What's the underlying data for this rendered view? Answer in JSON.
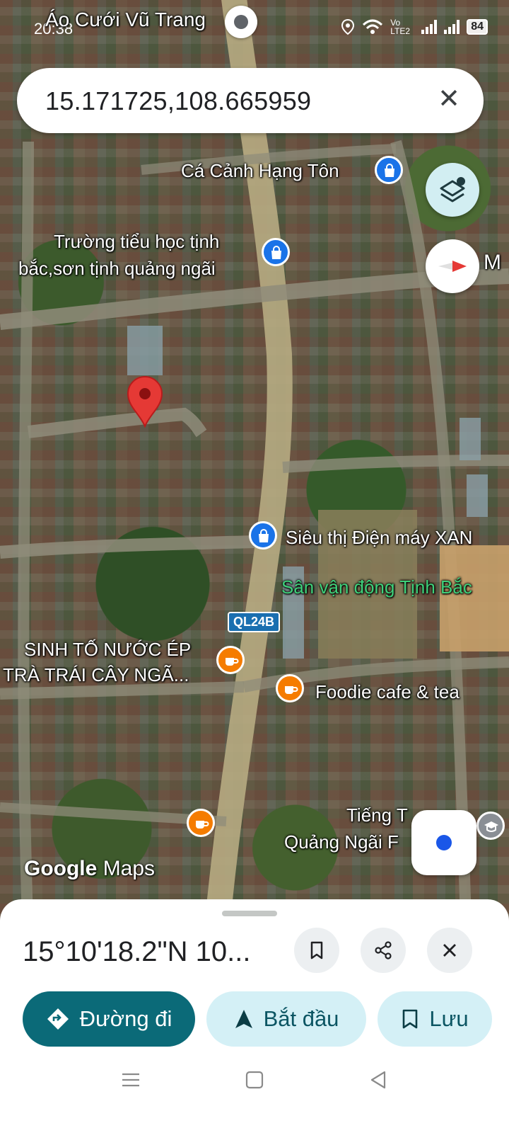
{
  "status_bar": {
    "time": "20:38",
    "network": "Vo LTE2",
    "battery": "84"
  },
  "search": {
    "query": "15.171725,108.665959"
  },
  "map": {
    "labels": {
      "top_place": "Áo Cưới Vũ Trang",
      "ca_canh": "Cá Cảnh Hạng Tôn",
      "school_line1": "Trường tiểu học tịnh",
      "school_line2": "bắc,sơn tịnh quảng ngãi",
      "edge_label": "M",
      "electronics": "Siêu thị Điện máy XAN",
      "stadium": "Sân vận động Tịnh Bắc",
      "route": "QL24B",
      "juice_line1": "SINH TỐ NƯỚC ÉP",
      "juice_line2": "TRÀ TRÁI CÂY NGÃ...",
      "foodie": "Foodie cafe & tea",
      "tieng_line1": "Tiếng T",
      "tieng_line2": "Quảng Ngãi F"
    },
    "watermark_google": "Google",
    "watermark_maps": "Maps"
  },
  "sheet": {
    "coordinates_title": "15°10'18.2\"N 10...",
    "directions_label": "Đường đi",
    "start_label": "Bắt đầu",
    "save_label": "Lưu"
  },
  "colors": {
    "primary_button": "#0b6a78",
    "secondary_button": "#d4f0f6",
    "pin": "#e53935",
    "shop_poi": "#1a73e8",
    "cafe_poi": "#f57c00"
  },
  "icons": [
    "location-icon",
    "wifi-icon",
    "signal-icon",
    "battery-icon",
    "close-icon",
    "layers-icon",
    "compass-icon",
    "shopping-bag-icon",
    "coffee-cup-icon",
    "school-icon",
    "map-pin-icon",
    "my-location-icon",
    "bookmark-icon",
    "share-icon",
    "directions-icon",
    "navigation-arrow-icon",
    "menu-icon",
    "home-square-icon",
    "back-triangle-icon"
  ]
}
